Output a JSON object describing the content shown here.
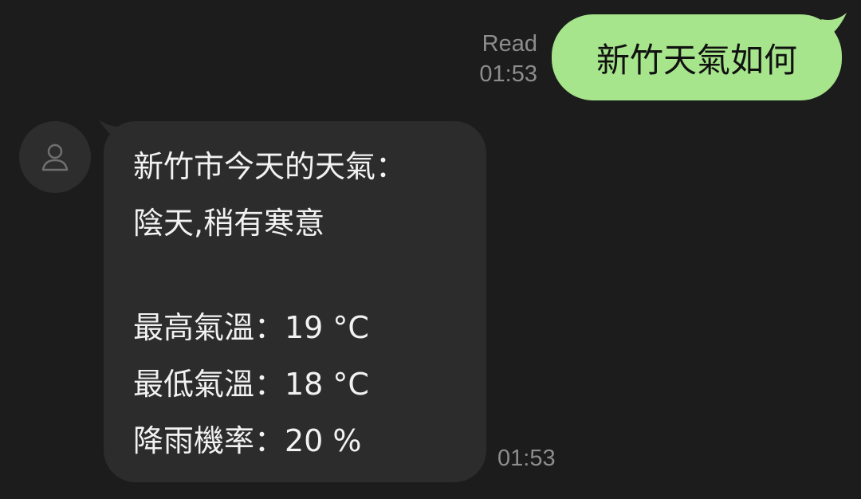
{
  "sent_message": {
    "status": "Read",
    "time": "01:53",
    "text": "新竹天氣如何",
    "bubble_color": "#a6e58b"
  },
  "received_message": {
    "avatar_icon": "person-icon",
    "lines": [
      "新竹市今天的天氣：",
      "陰天,稍有寒意",
      "",
      "最高氣溫：19 °C",
      "最低氣溫：18 °C",
      "降雨機率：20 %"
    ],
    "time": "01:53",
    "bubble_color": "#2c2c2d"
  },
  "background_color": "#1c1c1d"
}
